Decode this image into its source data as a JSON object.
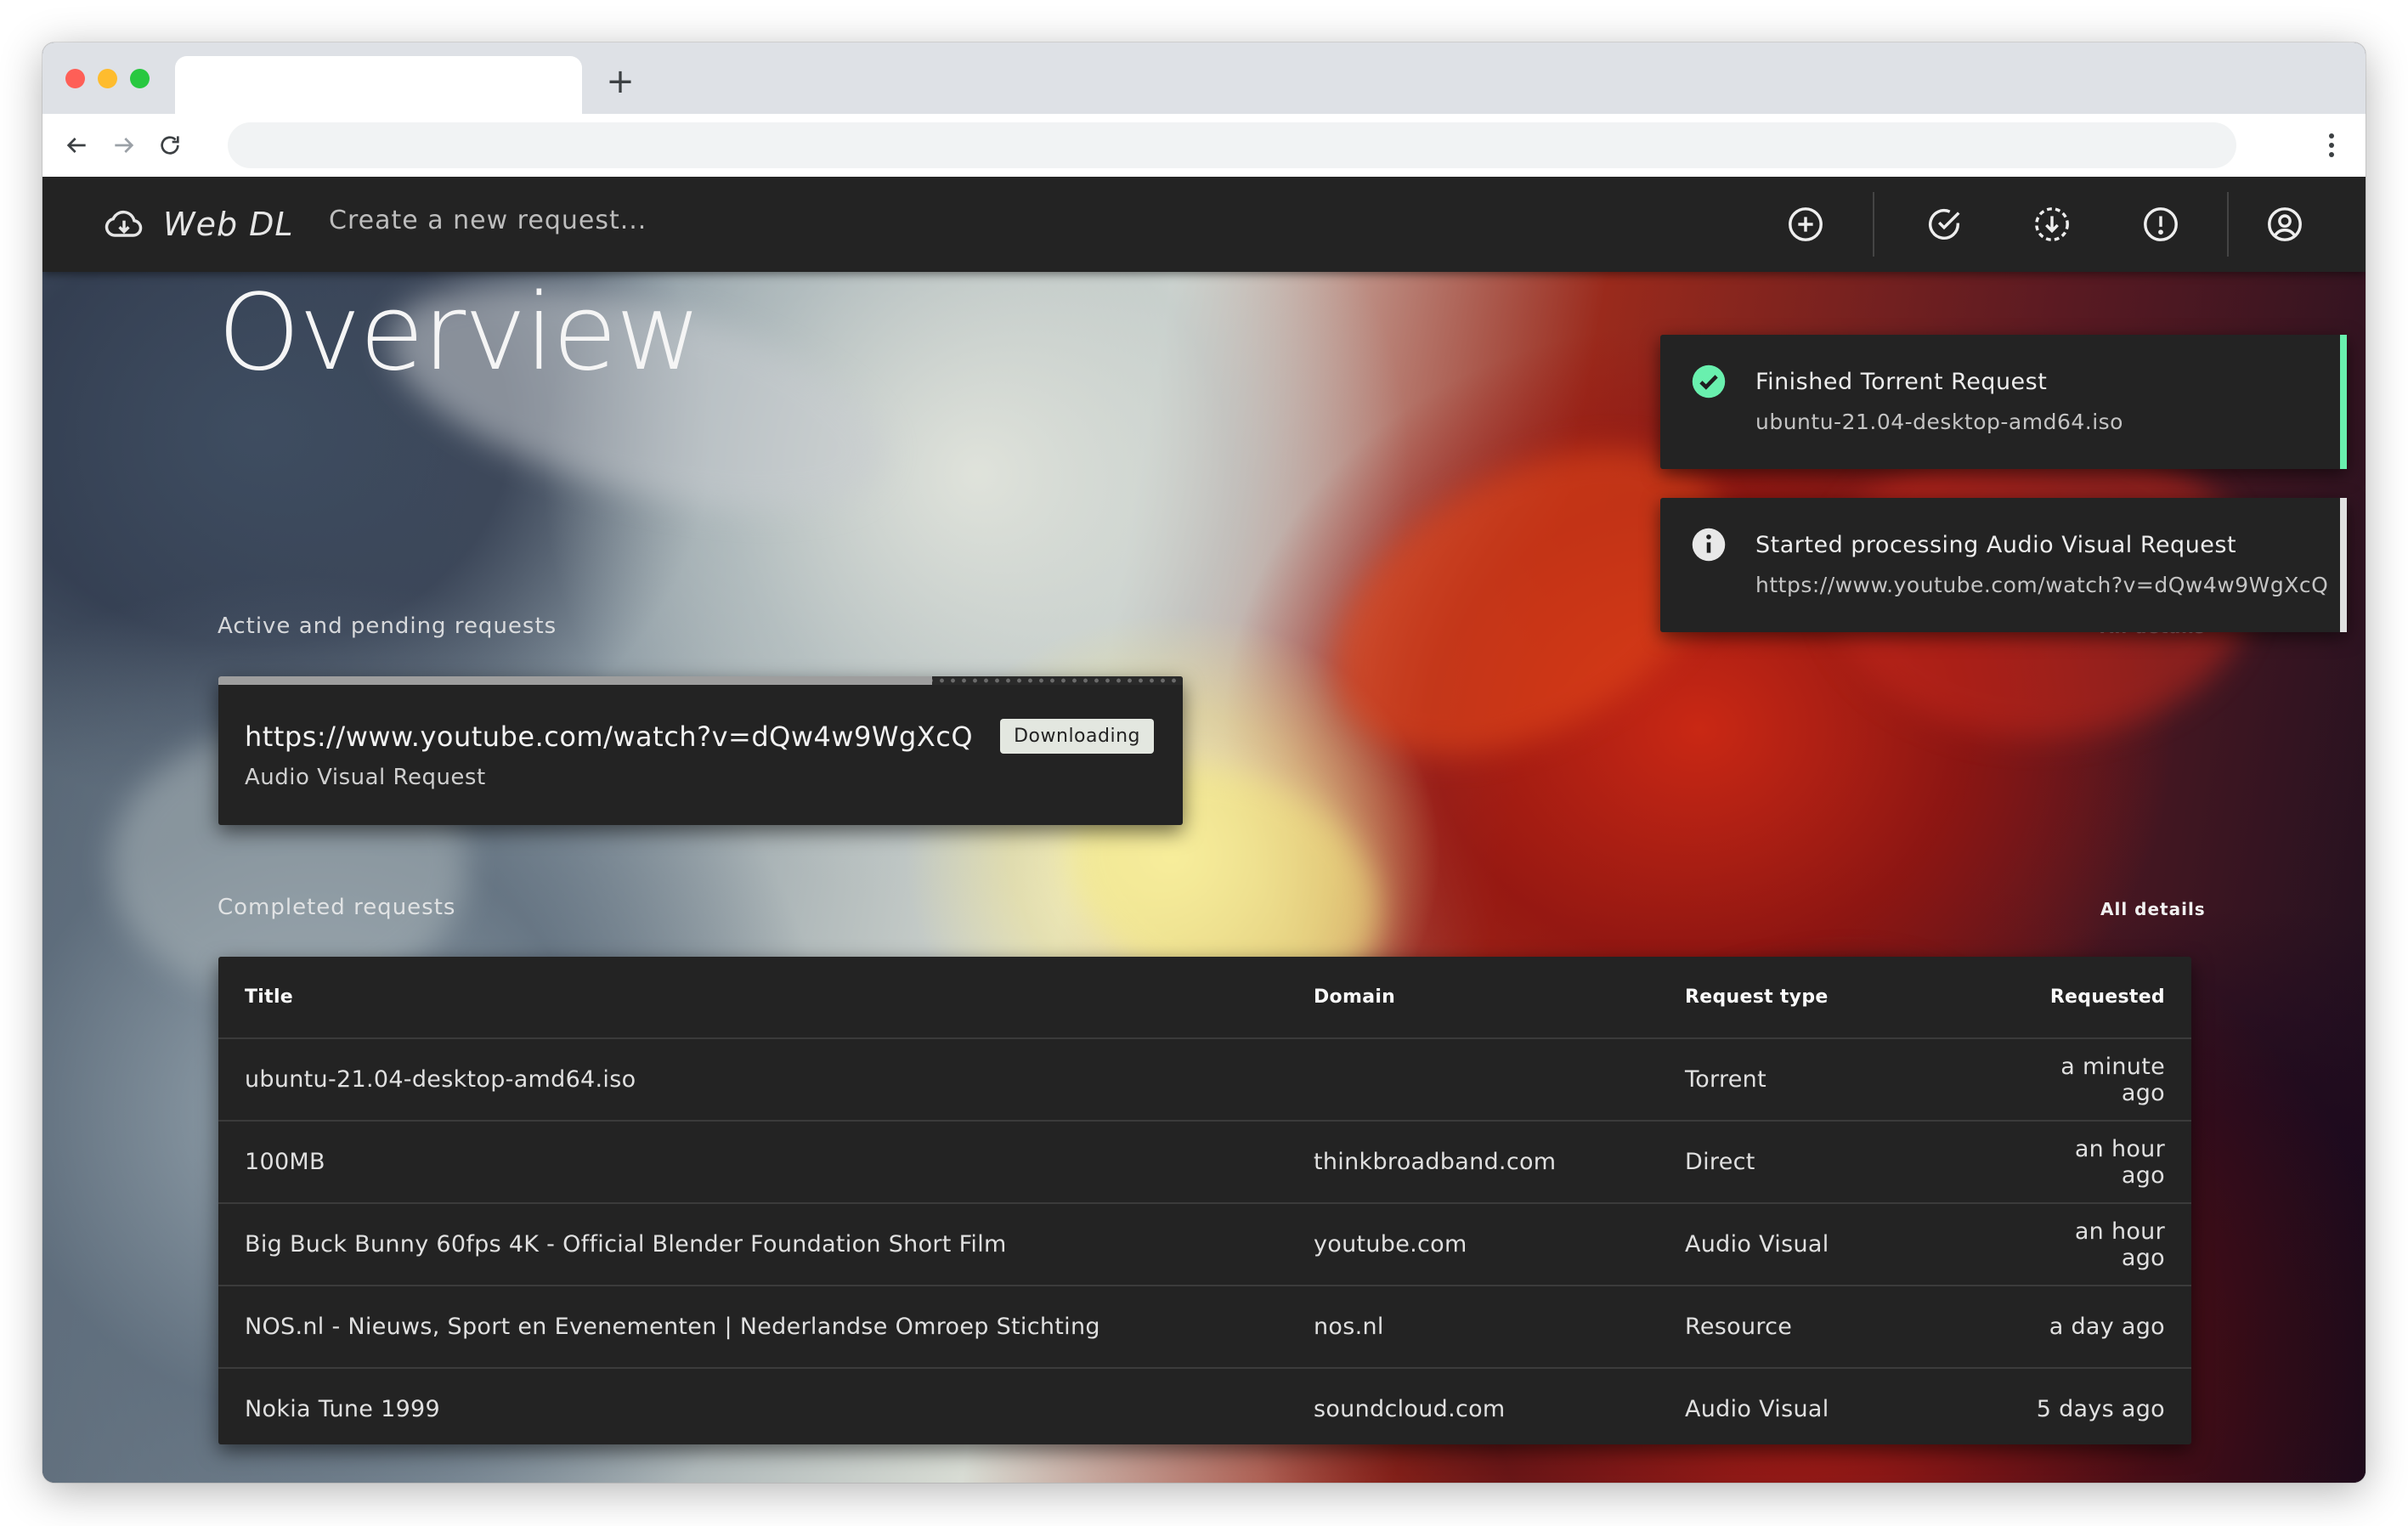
{
  "browser": {
    "tab_title": "",
    "new_tab": "+",
    "address": ""
  },
  "app": {
    "name": "Web DL",
    "new_request_placeholder": "Create a new request...",
    "actions": [
      {
        "icon": "plus-circle-icon"
      },
      {
        "icon": "check-circle-icon"
      },
      {
        "icon": "download-circle-icon"
      },
      {
        "icon": "alert-circle-icon"
      },
      {
        "icon": "user-circle-icon"
      }
    ]
  },
  "page": {
    "title": "Overview",
    "active_label": "Active and pending requests",
    "completed_label": "Completed requests",
    "all_details": "All details"
  },
  "active_requests": [
    {
      "url": "https://www.youtube.com/watch?v=dQw4w9WgXcQ",
      "type": "Audio Visual Request",
      "status": "Downloading",
      "progress": 0.74
    }
  ],
  "completed": {
    "headers": [
      "Title",
      "Domain",
      "Request type",
      "Requested"
    ],
    "rows": [
      {
        "title": "ubuntu-21.04-desktop-amd64.iso",
        "domain": "",
        "type": "Torrent",
        "requested": "a minute ago"
      },
      {
        "title": "100MB",
        "domain": "thinkbroadband.com",
        "type": "Direct",
        "requested": "an hour ago"
      },
      {
        "title": "Big Buck Bunny 60fps 4K - Official Blender Foundation Short Film",
        "domain": "youtube.com",
        "type": "Audio Visual",
        "requested": "an hour ago"
      },
      {
        "title": "NOS.nl - Nieuws, Sport en Evenementen | Nederlandse Omroep Stichting",
        "domain": "nos.nl",
        "type": "Resource",
        "requested": "a day ago"
      },
      {
        "title": "Nokia Tune 1999",
        "domain": "soundcloud.com",
        "type": "Audio Visual",
        "requested": "5 days ago"
      }
    ]
  },
  "notifications": [
    {
      "icon": "check-circle-icon",
      "title": "Finished Torrent Request",
      "detail": "ubuntu-21.04-desktop-amd64.iso",
      "accent": "#69f0ae"
    },
    {
      "icon": "info-circle-icon",
      "title": "Started processing Audio Visual Request",
      "detail": "https://www.youtube.com/watch?v=dQw4w9WgXcQ",
      "accent": "#e0e0e0"
    }
  ],
  "colors": {
    "appbar": "#232323",
    "card": "#232323",
    "success": "#69f0ae",
    "badge": "#e3e7e0"
  }
}
